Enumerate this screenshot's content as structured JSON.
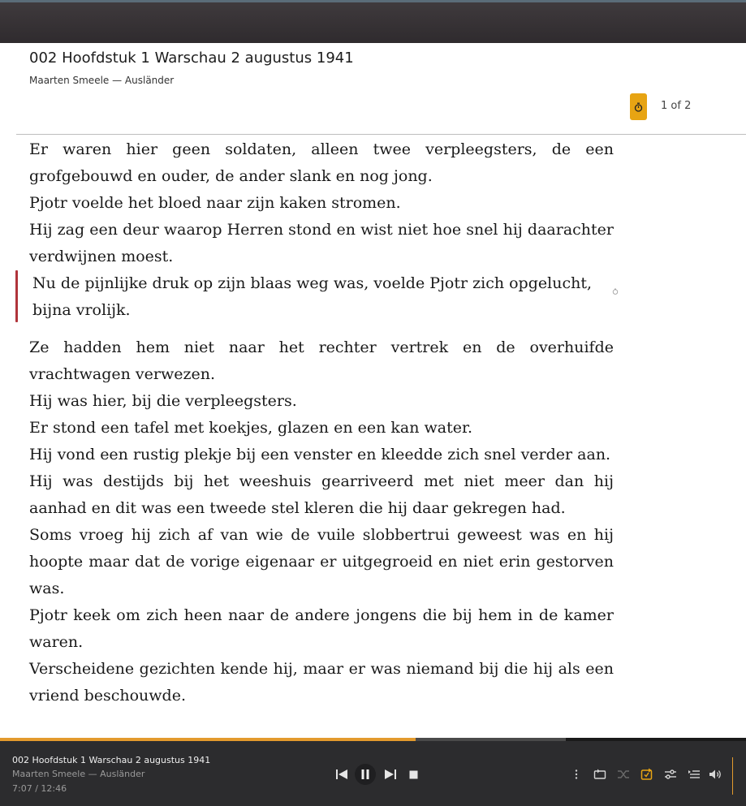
{
  "header": {
    "chapter_title": "002 Hoofdstuk 1 Warschau 2 augustus 1941",
    "subtitle": "Maarten Smeele — Ausländer",
    "page_indicator": "1 of 2",
    "timer_icon": "timer-icon",
    "accent_color": "#e7a413"
  },
  "content": {
    "paragraphs": [
      "Er waren hier geen soldaten, alleen twee verpleegsters, de een grofgebouwd en ouder, de ander slank en nog jong.",
      "Pjotr voelde het bloed naar zijn kaken stromen.",
      "Hij zag een deur waarop Herren stond en wist niet hoe snel hij daarachter verdwijnen moest.",
      "Nu de pijnlijke druk op zijn blaas weg was, voelde Pjotr zich opgelucht, bijna vrolijk.",
      "Ze hadden hem niet naar het rechter vertrek en de overhuifde vrachtwagen verwezen.",
      "Hij was hier, bij die verpleegsters.",
      "Er stond een tafel met koekjes, glazen en een kan water.",
      "Hij vond een rustig plekje bij een venster en kleedde zich snel verder aan.",
      "Hij was destijds bij het weeshuis gearriveerd met niet meer dan hij aanhad en dit was een tweede stel kleren die hij daar gekregen had.",
      "Soms vroeg hij zich af van wie de vuile slobbertrui geweest was en hij hoopte maar dat de vorige eigenaar er uitgegroeid en niet erin gestorven was.",
      "Pjotr keek om zich heen naar de andere jongens die bij hem in de kamer waren.",
      "Verscheidene gezichten kende hij, maar er was niemand bij die hij als een vriend beschouwde."
    ],
    "highlight_color": "#b0343b"
  },
  "player": {
    "title": "002 Hoofdstuk 1 Warschau 2 augustus 1941",
    "subtitle": "Maarten Smeele — Ausländer",
    "time": "7:07 / 12:46",
    "progress_fraction": 0.557,
    "buffer_fraction": 0.758,
    "accent_color": "#e39a2d",
    "controls": [
      "skip-previous-icon",
      "pause-icon",
      "skip-next-icon",
      "stop-icon"
    ],
    "tools": [
      "more-icon",
      "repeat-icon",
      "shuffle-icon",
      "sync-icon",
      "equalizer-icon",
      "queue-icon",
      "volume-icon"
    ]
  }
}
